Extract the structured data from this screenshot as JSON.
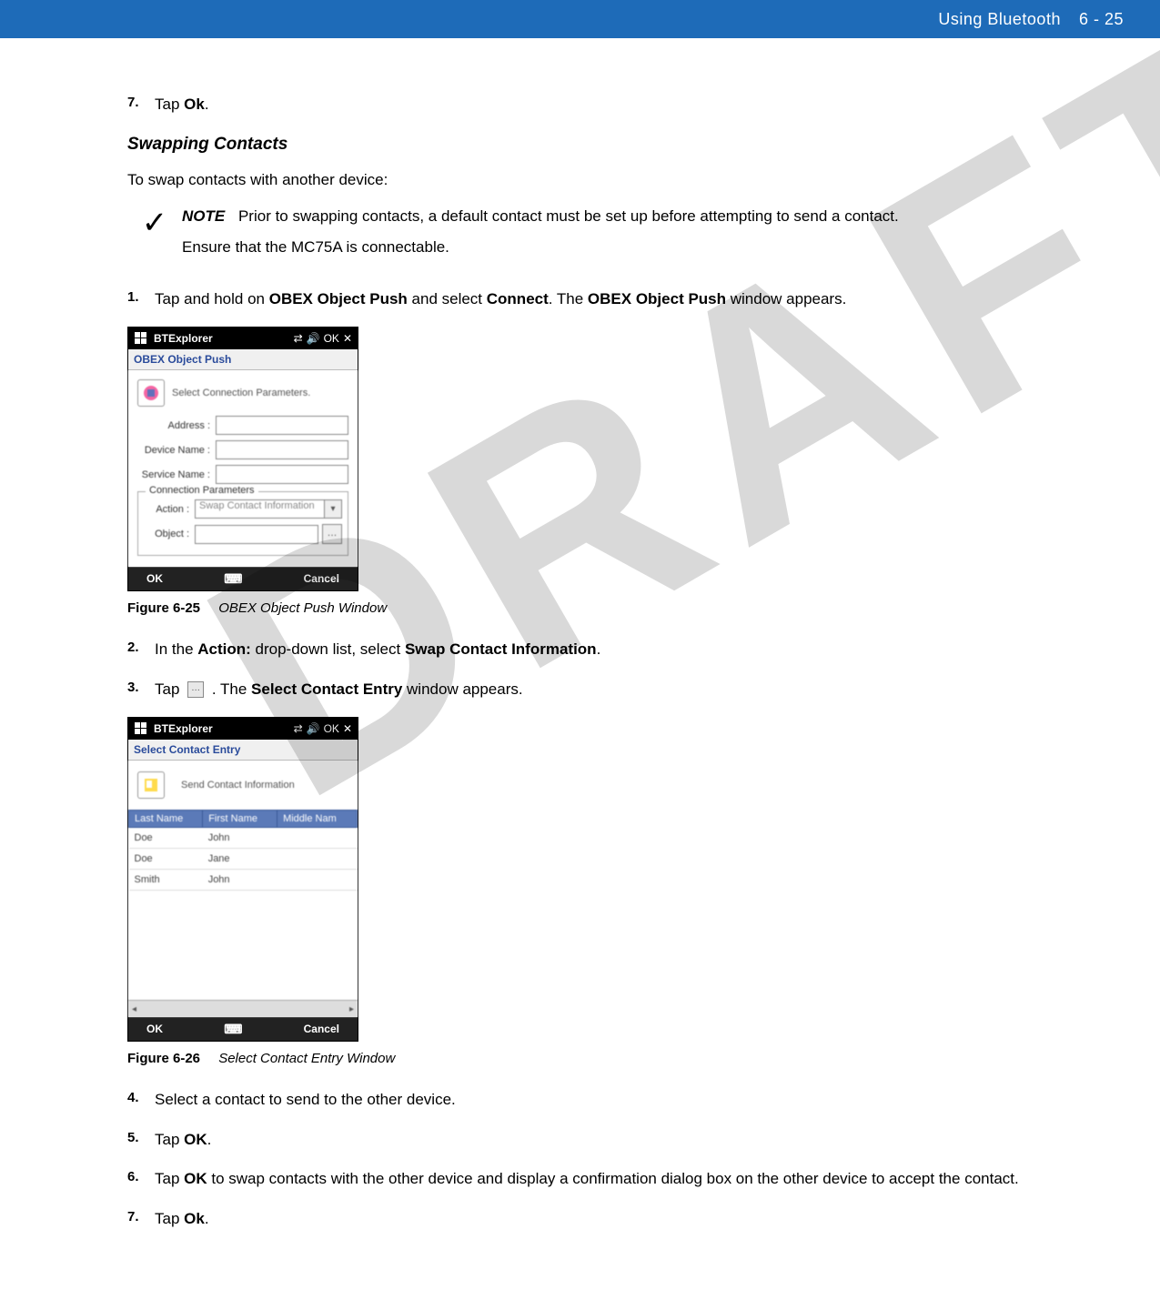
{
  "header": {
    "title": "Using Bluetooth",
    "page": "6 - 25"
  },
  "watermark": "DRAFT",
  "step7a": {
    "num": "7.",
    "pre": "Tap ",
    "b": "Ok",
    "post": "."
  },
  "h3": "Swapping Contacts",
  "intro": "To swap contacts with another device:",
  "note": {
    "label": "NOTE",
    "line1": "Prior to swapping contacts, a default contact must be set up before attempting to send a contact.",
    "line2": "Ensure that the MC75A is connectable."
  },
  "step1": {
    "num": "1.",
    "t1": "Tap and hold on ",
    "b1": "OBEX Object Push",
    "t2": " and select ",
    "b2": "Connect",
    "t3": ". The ",
    "b3": "OBEX Object Push",
    "t4": " window appears."
  },
  "fig25": {
    "label": "Figure 6-25",
    "title": "OBEX Object Push Window"
  },
  "step2": {
    "num": "2.",
    "t1": "In the ",
    "b1": "Action:",
    "t2": " drop-down list, select ",
    "b2": "Swap Contact Information",
    "t3": "."
  },
  "step3": {
    "num": "3.",
    "t1": "Tap ",
    "t2": " . The ",
    "b2": "Select Contact Entry",
    "t3": " window appears."
  },
  "fig26": {
    "label": "Figure 6-26",
    "title": "Select Contact Entry Window"
  },
  "step4": {
    "num": "4.",
    "text": "Select a contact to send to the other device."
  },
  "step5": {
    "num": "5.",
    "t1": "Tap ",
    "b1": "OK",
    "t2": "."
  },
  "step6": {
    "num": "6.",
    "t1": "Tap ",
    "b1": "OK",
    "t2": " to swap contacts with the other device and display a confirmation dialog box on the other device to accept the contact."
  },
  "step7b": {
    "num": "7.",
    "t1": "Tap ",
    "b1": "Ok",
    "t2": "."
  },
  "shot1": {
    "winTitle": "BTExplorer",
    "subTitle": "OBEX Object Push",
    "connText": "Select Connection Parameters.",
    "addrLabel": "Address :",
    "devLabel": "Device Name :",
    "svcLabel": "Service Name :",
    "groupTitle": "Connection Parameters",
    "actionLabel": "Action :",
    "actionValue": "Swap Contact Information",
    "objectLabel": "Object :",
    "ok": "OK",
    "cancel": "Cancel"
  },
  "shot2": {
    "winTitle": "BTExplorer",
    "subTitle": "Select Contact Entry",
    "sendText": "Send Contact Information",
    "col1": "Last Name",
    "col2": "First Name",
    "col3": "Middle Nam",
    "rows": [
      {
        "c1": "Doe",
        "c2": "John",
        "c3": ""
      },
      {
        "c1": "Doe",
        "c2": "Jane",
        "c3": ""
      },
      {
        "c1": "Smith",
        "c2": "John",
        "c3": ""
      }
    ],
    "ok": "OK",
    "cancel": "Cancel"
  }
}
